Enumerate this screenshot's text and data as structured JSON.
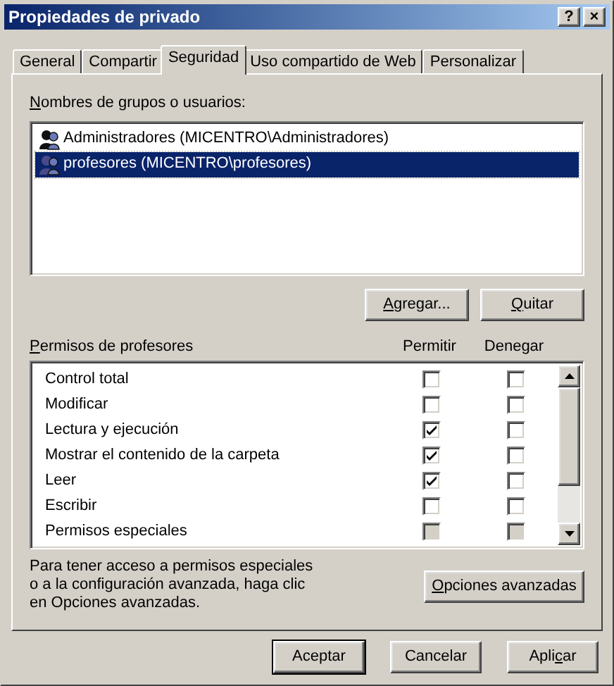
{
  "window": {
    "title": "Propiedades de privado",
    "title_buttons": [
      {
        "kind": "help",
        "label": "?"
      },
      {
        "kind": "close",
        "label": "×"
      }
    ]
  },
  "tabs": [
    {
      "label": "General",
      "selected": false
    },
    {
      "label": "Compartir",
      "selected": false
    },
    {
      "label": "Seguridad",
      "selected": true
    },
    {
      "label": "Uso compartido de Web",
      "selected": false
    },
    {
      "label": "Personalizar",
      "selected": false
    }
  ],
  "users_label": {
    "key": "N",
    "after": "ombres de grupos o usuarios:"
  },
  "users": [
    {
      "name": "Administradores (MICENTRO\\Administradores)",
      "selected": false
    },
    {
      "name": "profesores (MICENTRO\\profesores)",
      "selected": true
    }
  ],
  "user_buttons": [
    {
      "key": "A",
      "after": "gregar..."
    },
    {
      "key": "Q",
      "after": "uitar"
    }
  ],
  "permissions_label": {
    "key": "P",
    "after": "ermisos de profesores"
  },
  "columns": [
    "Permitir",
    "Denegar"
  ],
  "permissions": [
    {
      "name": "Control total",
      "allow": false,
      "deny": false,
      "disabled": false
    },
    {
      "name": "Modificar",
      "allow": false,
      "deny": false,
      "disabled": false
    },
    {
      "name": "Lectura y ejecución",
      "allow": true,
      "deny": false,
      "disabled": false
    },
    {
      "name": "Mostrar el contenido de la carpeta",
      "allow": true,
      "deny": false,
      "disabled": false
    },
    {
      "name": "Leer",
      "allow": true,
      "deny": false,
      "disabled": false
    },
    {
      "name": "Escribir",
      "allow": false,
      "deny": false,
      "disabled": false
    },
    {
      "name": "Permisos especiales",
      "allow": false,
      "deny": false,
      "disabled": true
    }
  ],
  "advanced_note": "Para tener acceso a permisos especiales o a la configuración avanzada, haga clic en Opciones avanzadas.",
  "advanced_button": {
    "key": "O",
    "after": "pciones avanzadas"
  },
  "footer_buttons": [
    {
      "label": {
        "before": "Aceptar"
      },
      "default": true
    },
    {
      "label": {
        "before": "Cancelar"
      },
      "default": false
    },
    {
      "label": {
        "before": "Apli",
        "key": "c",
        "after": "ar"
      },
      "default": false
    }
  ]
}
